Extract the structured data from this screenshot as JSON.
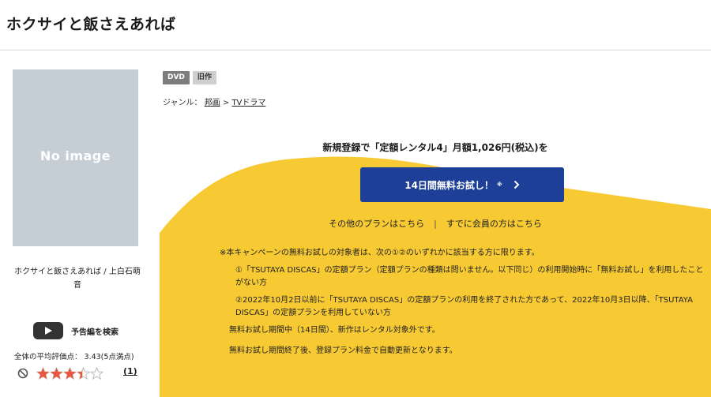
{
  "page": {
    "title": "ホクサイと飯さえあれば"
  },
  "poster": {
    "text": "No image"
  },
  "caption": "ホクサイと飯さえあれば / 上白石萌音",
  "trailer": {
    "label": "予告編を検索",
    "icon": "play-icon"
  },
  "rating": {
    "label": "全体の平均評価点： 3.43(5点満点)",
    "value": 3.43,
    "max": 5,
    "review_count": "(1)",
    "star_color": "#e8573e"
  },
  "tags": {
    "dvd": "DVD",
    "old": "旧作"
  },
  "genre": {
    "prefix": "ジャンル：",
    "genre1": "邦画",
    "sep": ">",
    "genre2": "TVドラマ"
  },
  "promo": {
    "bg_color": "#f7c932",
    "headline": "新規登録で「定額レンタル4」月額1,026円(税込)を",
    "cta_label": "14日間無料お試し！",
    "cta_sup": "※",
    "cta_color": "#1d3f97",
    "other_plans": "その他のプランはこちら",
    "separator": "|",
    "member_link": "すでに会員の方はこちら"
  },
  "notes": {
    "main": "※本キャンペーンの無料お試しの対象者は、次の①②のいずれかに該当する方に限ります。",
    "item1": "①「TSUTAYA DISCAS」の定額プラン（定額プランの種類は問いません。以下同じ）の利用開始時に「無料お試し」を利用したことがない方",
    "item2": "②2022年10月2日以前に「TSUTAYA DISCAS」の定額プランの利用を終了された方であって、2022年10月3日以降、「TSUTAYA DISCAS」の定額プランを利用していない方",
    "period": "無料お試し期間中（14日間）、新作はレンタル対象外です。",
    "after": "無料お試し期間終了後、登録プラン料金で自動更新となります。"
  }
}
